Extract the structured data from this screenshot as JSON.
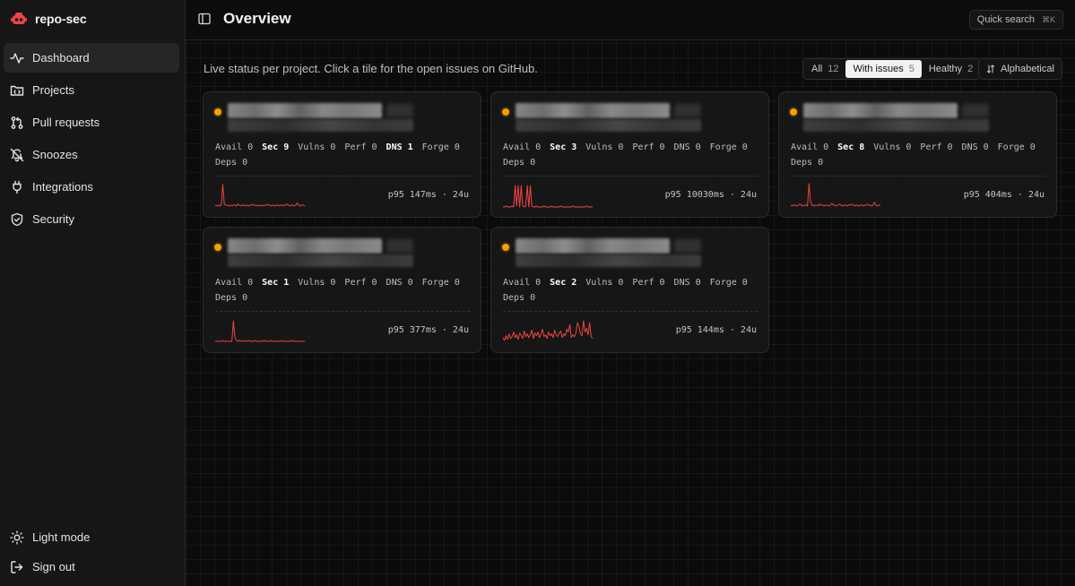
{
  "app": {
    "name": "repo-sec"
  },
  "sidebar": {
    "items": [
      {
        "label": "Dashboard",
        "icon": "activity-icon",
        "active": true
      },
      {
        "label": "Projects",
        "icon": "folder-code-icon",
        "active": false
      },
      {
        "label": "Pull requests",
        "icon": "git-pull-request-icon",
        "active": false
      },
      {
        "label": "Snoozes",
        "icon": "bell-off-icon",
        "active": false
      },
      {
        "label": "Integrations",
        "icon": "plug-icon",
        "active": false
      },
      {
        "label": "Security",
        "icon": "shield-check-icon",
        "active": false
      }
    ],
    "light_mode": "Light mode",
    "sign_out": "Sign out"
  },
  "header": {
    "title": "Overview",
    "quick_search": "Quick search",
    "shortcut": "⌘K"
  },
  "subtitle": "Live status per project. Click a tile for the open issues on GitHub.",
  "filters": [
    {
      "label": "All",
      "count": "12",
      "active": false
    },
    {
      "label": "With issues",
      "count": "5",
      "active": true
    },
    {
      "label": "Healthy",
      "count": "2",
      "active": false
    }
  ],
  "sort": {
    "label": "Alphabetical"
  },
  "colors": {
    "status_dot": "#f59e0b",
    "sparkline": "#ef4444",
    "accent_active": "#f2f2f2"
  },
  "projects": [
    {
      "metrics": {
        "avail": "Avail 0",
        "sec": "Sec 9",
        "vulns": "Vulns 0",
        "perf": "Perf 0",
        "dns": "DNS 1",
        "forge": "Forge 0",
        "deps": "Deps 0"
      },
      "p95": "p95 147ms · 24u",
      "spark": [
        3,
        2,
        3,
        2,
        3,
        25,
        4,
        3,
        3,
        2,
        3,
        2,
        3,
        3,
        2,
        4,
        3,
        2,
        3,
        3,
        2,
        3,
        2,
        3,
        3,
        4,
        3,
        2,
        3,
        3,
        2,
        3,
        2,
        3,
        4,
        3,
        3,
        2,
        3,
        2,
        3,
        3,
        2,
        3,
        3,
        2,
        3,
        4,
        3,
        2,
        3,
        3,
        2,
        3,
        5,
        3,
        2,
        3,
        3,
        2
      ]
    },
    {
      "metrics": {
        "avail": "Avail 0",
        "sec": "Sec 3",
        "vulns": "Vulns 0",
        "perf": "Perf 0",
        "dns": "DNS 0",
        "forge": "Forge 0",
        "deps": "Deps 0"
      },
      "p95": "p95 10030ms · 24u",
      "spark": [
        1,
        1,
        2,
        1,
        1,
        1,
        2,
        1,
        24,
        2,
        24,
        1,
        24,
        2,
        1,
        2,
        24,
        1,
        24,
        2,
        1,
        1,
        2,
        1,
        1,
        1,
        1,
        2,
        1,
        1,
        1,
        1,
        2,
        1,
        1,
        1,
        1,
        1,
        2,
        1,
        1,
        1,
        1,
        1,
        1,
        1,
        2,
        1,
        1,
        1,
        1,
        1,
        1,
        1,
        1,
        2,
        1,
        1,
        1,
        1
      ]
    },
    {
      "metrics": {
        "avail": "Avail 0",
        "sec": "Sec 8",
        "vulns": "Vulns 0",
        "perf": "Perf 0",
        "dns": "DNS 0",
        "forge": "Forge 0",
        "deps": "Deps 0"
      },
      "p95": "p95 404ms · 24u",
      "spark": [
        3,
        2,
        3,
        3,
        2,
        3,
        4,
        3,
        2,
        3,
        3,
        2,
        26,
        6,
        3,
        2,
        3,
        3,
        2,
        4,
        3,
        3,
        2,
        3,
        3,
        2,
        3,
        5,
        3,
        3,
        2,
        3,
        4,
        3,
        2,
        3,
        3,
        2,
        3,
        3,
        4,
        3,
        2,
        3,
        3,
        2,
        3,
        3,
        2,
        3,
        4,
        3,
        3,
        2,
        3,
        6,
        3,
        2,
        3,
        3
      ]
    },
    {
      "metrics": {
        "avail": "Avail 0",
        "sec": "Sec 1",
        "vulns": "Vulns 0",
        "perf": "Perf 0",
        "dns": "DNS 0",
        "forge": "Forge 0",
        "deps": "Deps 0"
      },
      "p95": "p95 377ms · 24u",
      "spark": [
        2,
        2,
        2,
        2,
        2,
        3,
        2,
        2,
        2,
        2,
        2,
        2,
        24,
        6,
        3,
        2,
        3,
        2,
        2,
        3,
        2,
        2,
        3,
        2,
        2,
        2,
        3,
        2,
        2,
        2,
        2,
        2,
        3,
        2,
        2,
        2,
        2,
        3,
        2,
        2,
        2,
        2,
        2,
        2,
        3,
        2,
        2,
        2,
        2,
        2,
        2,
        3,
        2,
        2,
        2,
        2,
        2,
        2,
        2,
        2
      ]
    },
    {
      "metrics": {
        "avail": "Avail 0",
        "sec": "Sec 2",
        "vulns": "Vulns 0",
        "perf": "Perf 0",
        "dns": "DNS 0",
        "forge": "Forge 0",
        "deps": "Deps 0"
      },
      "p95": "p95 144ms · 24u",
      "spark": [
        6,
        3,
        8,
        4,
        10,
        5,
        7,
        12,
        6,
        9,
        4,
        11,
        8,
        5,
        13,
        7,
        10,
        6,
        9,
        14,
        5,
        11,
        8,
        12,
        6,
        10,
        15,
        7,
        9,
        5,
        12,
        8,
        10,
        6,
        14,
        9,
        7,
        11,
        13,
        6,
        10,
        8,
        15,
        12,
        20,
        6,
        9,
        7,
        11,
        22,
        18,
        10,
        8,
        24,
        12,
        16,
        9,
        22,
        7,
        5
      ]
    }
  ]
}
